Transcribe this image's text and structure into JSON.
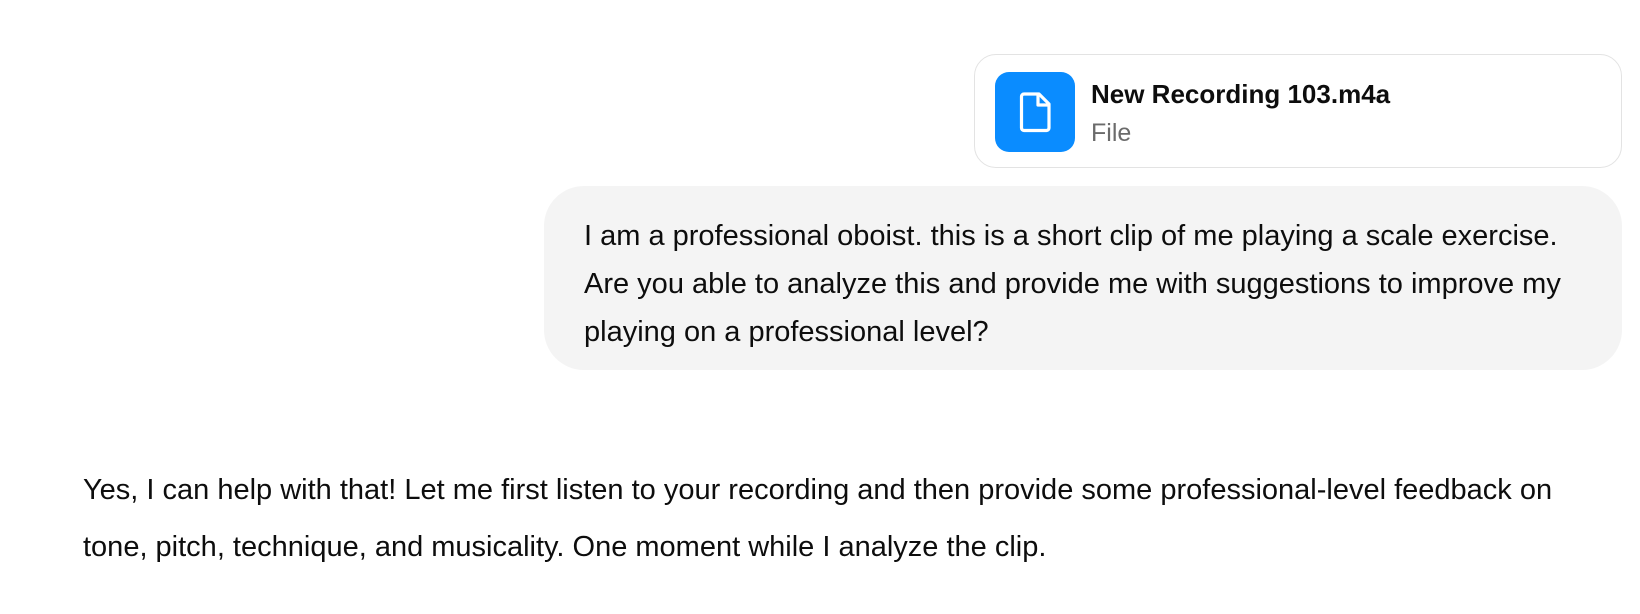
{
  "attachment": {
    "name": "New Recording 103.m4a",
    "type_label": "File",
    "icon": "document-icon",
    "icon_color": "#0a8cff"
  },
  "user_message": {
    "text": "I am a professional oboist. this is a short clip of me playing a scale exercise. Are you able to analyze this and provide me with suggestions to improve my playing on a professional level?"
  },
  "assistant_message": {
    "text": "Yes, I can help with that! Let me first listen to your recording and then provide some professional-level feedback on tone, pitch, technique, and musicality. One moment while I analyze the clip."
  },
  "colors": {
    "user_bubble_bg": "#f4f4f4",
    "card_border": "#e3e3e3",
    "text_primary": "#0d0d0d",
    "text_secondary": "#6b6b6b"
  }
}
